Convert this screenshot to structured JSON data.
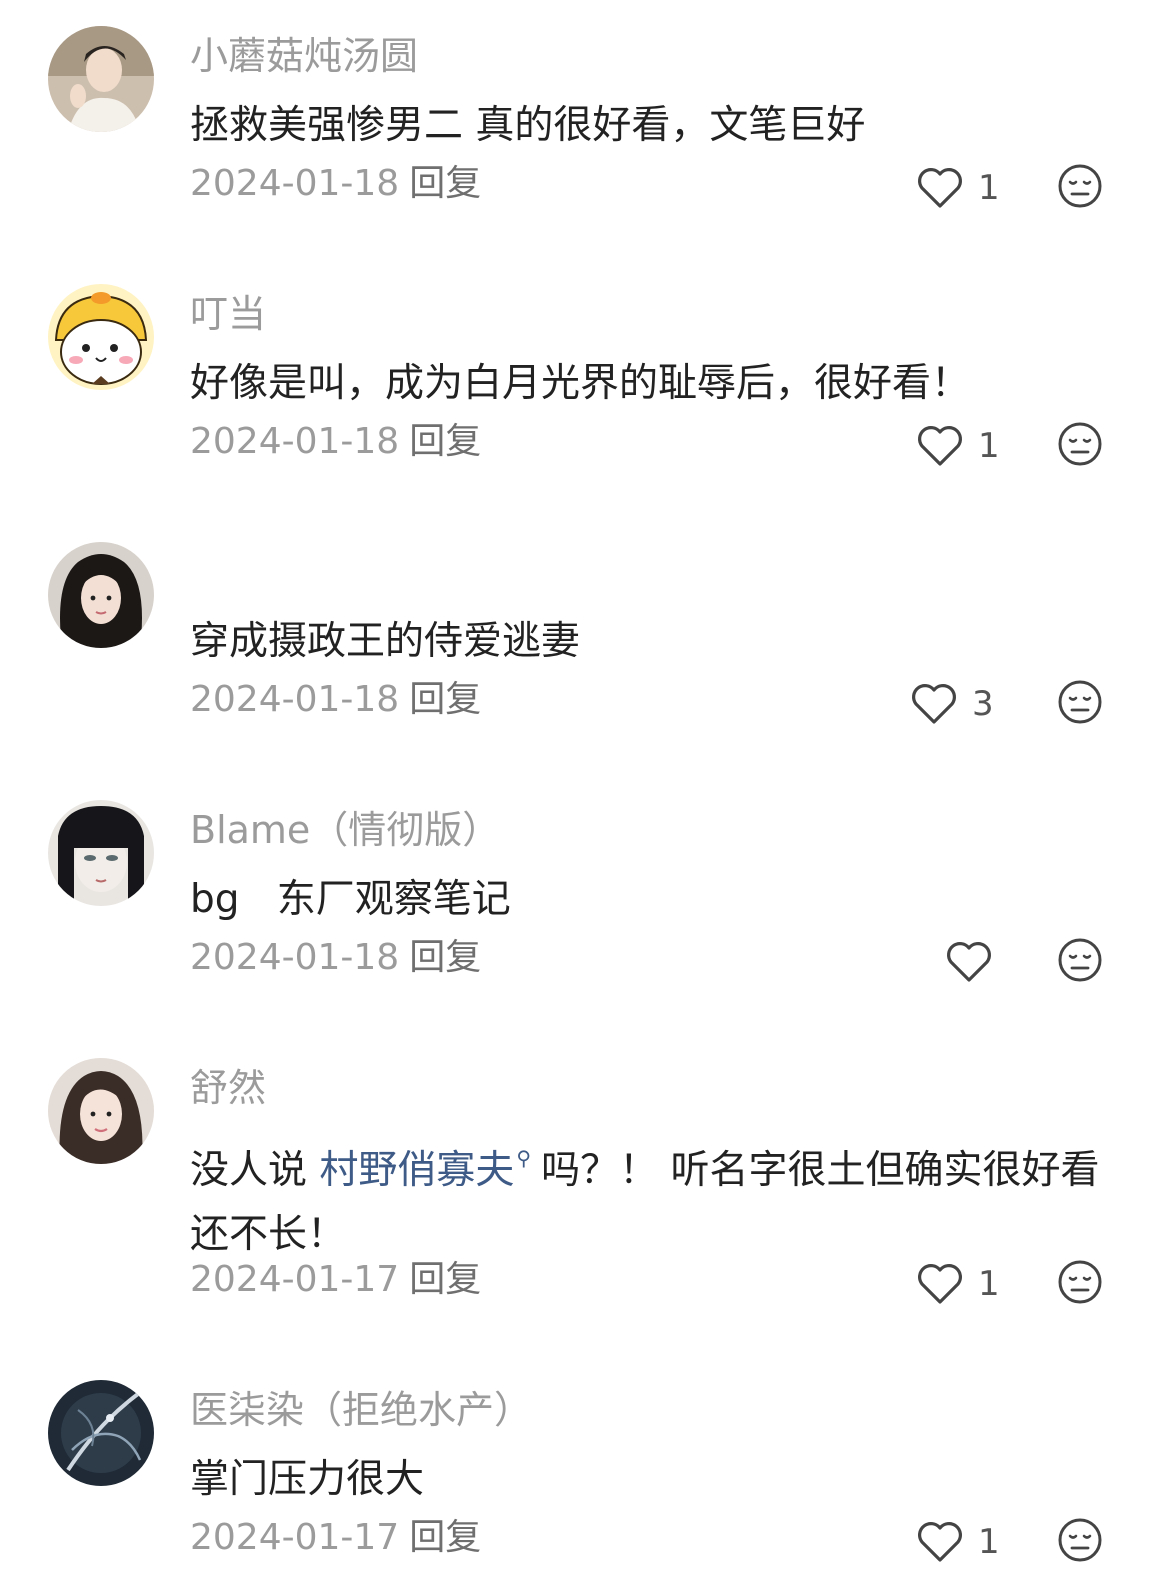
{
  "comments": [
    {
      "username": "小蘑菇炖汤圆",
      "text": "拯救美强惨男二 真的很好看，文笔巨好",
      "date": "2024-01-18",
      "reply_label": "回复",
      "likes": "1",
      "avatar_icon": "avatar-boy-photo"
    },
    {
      "username": "叮当",
      "text": "好像是叫，成为白月光界的耻辱后，很好看！",
      "date": "2024-01-18",
      "reply_label": "回复",
      "likes": "1",
      "avatar_icon": "avatar-duck-cartoon"
    },
    {
      "username": "",
      "text": "穿成摄政王的侍爱逃妻",
      "date": "2024-01-18",
      "reply_label": "回复",
      "likes": "3",
      "avatar_icon": "avatar-girl-photo"
    },
    {
      "username": "Blame（情彻版）",
      "text": "bg   东厂观察笔记",
      "date": "2024-01-18",
      "reply_label": "回复",
      "likes": "",
      "avatar_icon": "avatar-anime-girl"
    },
    {
      "username": "舒然",
      "text_before": "没人说 ",
      "link_text": "村野俏寡夫",
      "text_after": "吗？！ 听名字很土但确实很好看还不长！",
      "date": "2024-01-17",
      "reply_label": "回复",
      "likes": "1",
      "avatar_icon": "avatar-woman-photo"
    },
    {
      "username": "医柒染（拒绝水产）",
      "text": "掌门压力很大",
      "date": "2024-01-17",
      "reply_label": "回复",
      "likes": "1",
      "avatar_icon": "avatar-sword-art"
    }
  ],
  "icons": {
    "like": "heart-outline-icon",
    "dislike": "meh-face-icon",
    "link": "search-icon"
  },
  "colors": {
    "username": "#9b9b9b",
    "text": "#222222",
    "link": "#3e5a86",
    "icon": "#444444"
  }
}
